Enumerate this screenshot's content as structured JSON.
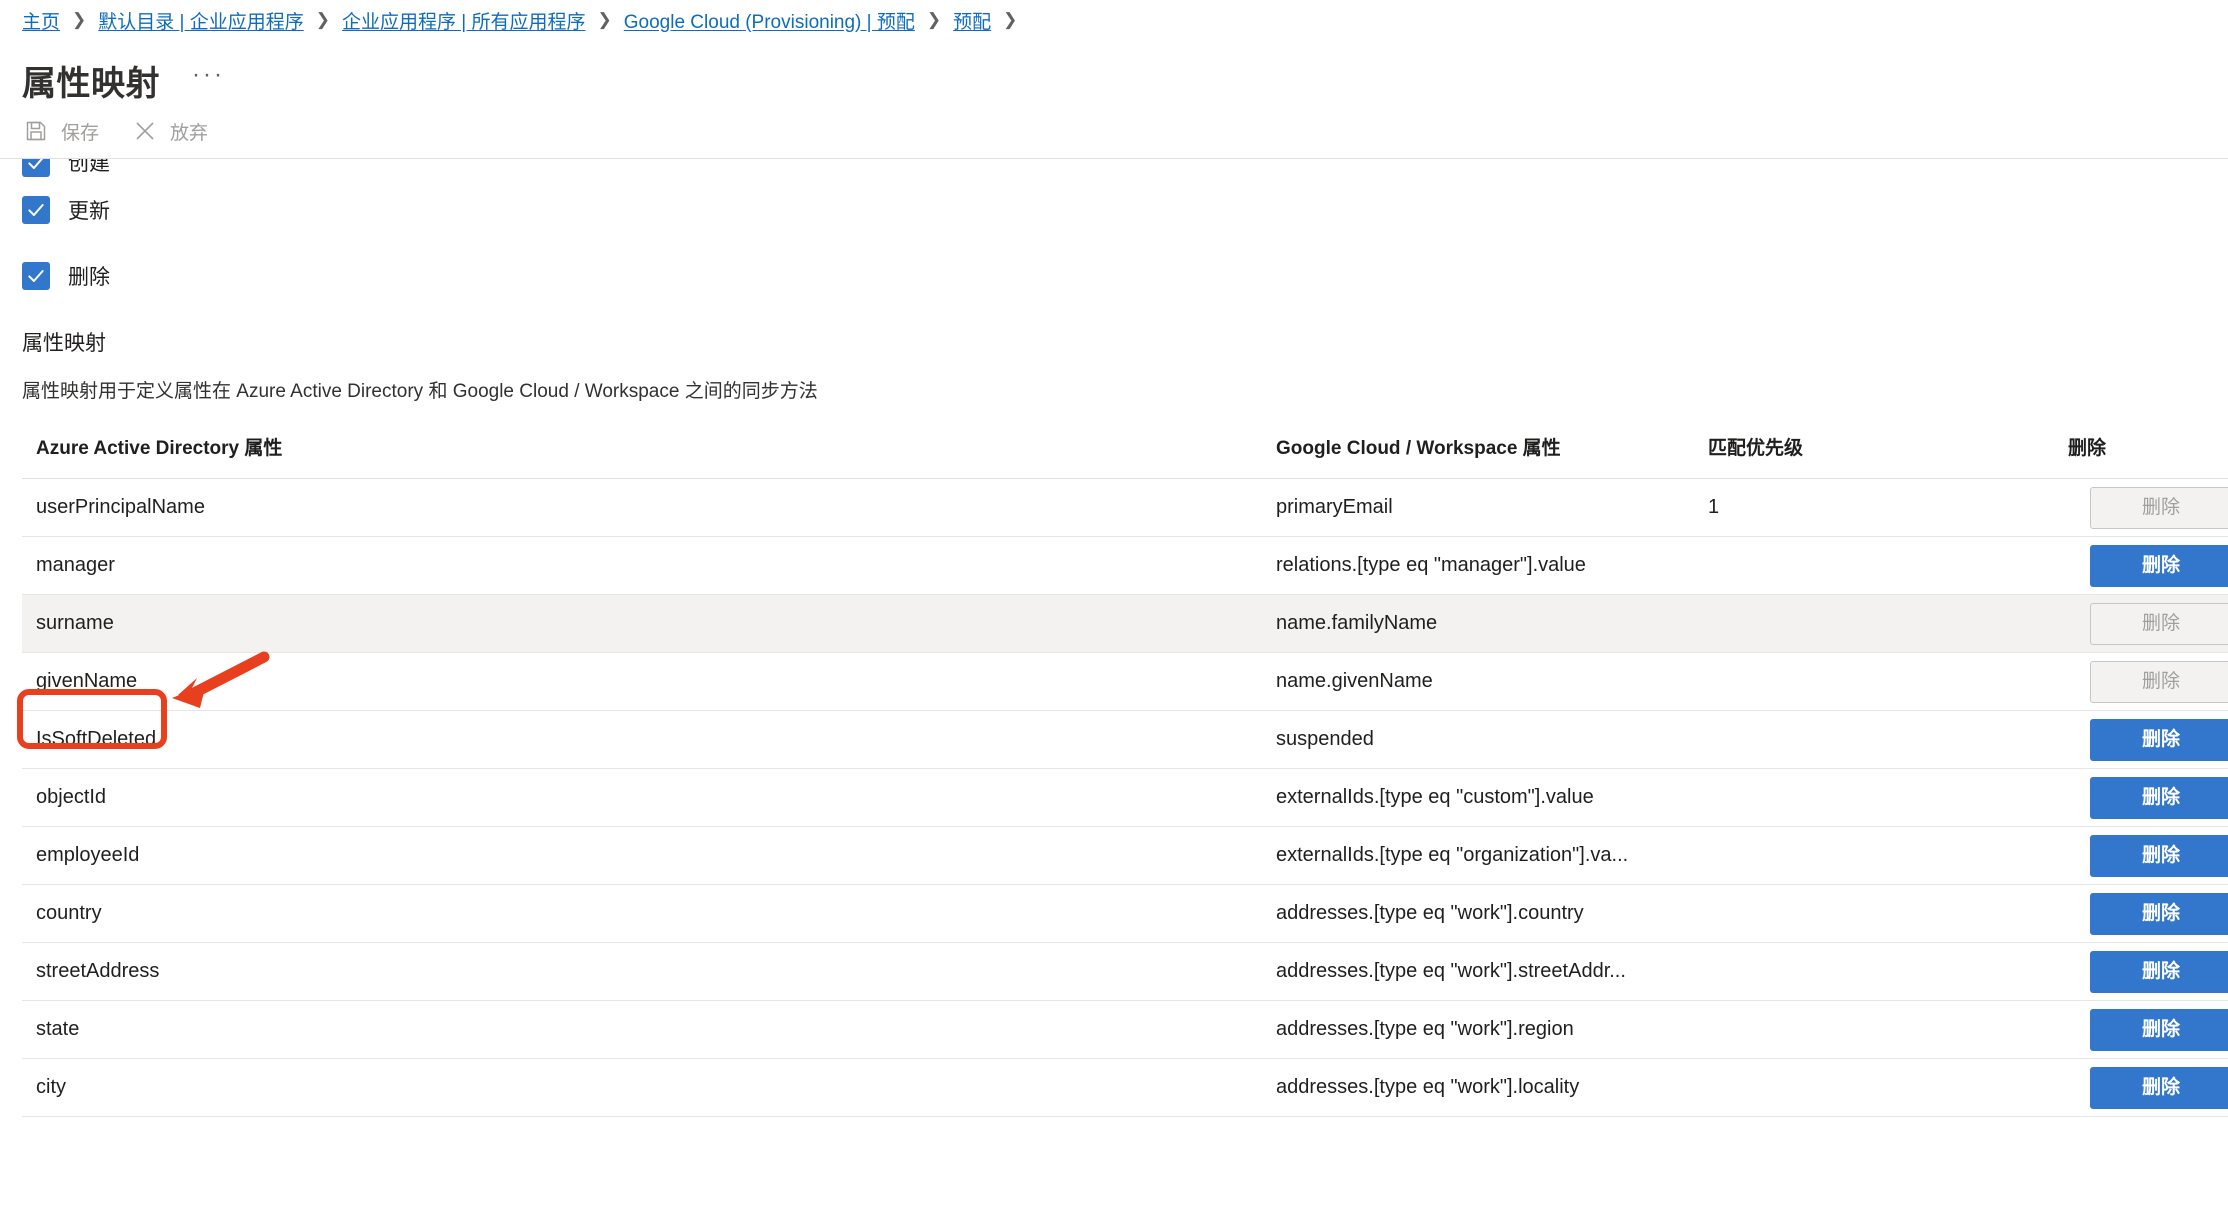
{
  "breadcrumb": {
    "items": [
      {
        "label": "主页"
      },
      {
        "label": "默认目录 | 企业应用程序"
      },
      {
        "label": "企业应用程序 | 所有应用程序"
      },
      {
        "label": "Google Cloud (Provisioning) | 预配"
      },
      {
        "label": "预配"
      }
    ],
    "separator": "❯"
  },
  "header": {
    "title": "属性映射",
    "more_label": "···"
  },
  "toolbar": {
    "save_label": "保存",
    "discard_label": "放弃",
    "save_icon": "save-floppy-icon",
    "discard_icon": "close-x-icon"
  },
  "checkboxes": [
    {
      "label": "创建",
      "checked": true,
      "clipped": true
    },
    {
      "label": "更新",
      "checked": true,
      "clipped": false
    },
    {
      "label": "删除",
      "checked": true,
      "clipped": false
    }
  ],
  "section": {
    "title": "属性映射",
    "description": "属性映射用于定义属性在 Azure Active Directory 和 Google Cloud / Workspace 之间的同步方法"
  },
  "table": {
    "columns": [
      "Azure Active Directory 属性",
      "Google Cloud / Workspace 属性",
      "匹配优先级",
      "删除"
    ],
    "delete_label": "删除",
    "rows": [
      {
        "source": "userPrincipalName",
        "target": "primaryEmail",
        "priority": "1",
        "delete_enabled": false,
        "highlight": false
      },
      {
        "source": "manager",
        "target": "relations.[type eq \"manager\"].value",
        "priority": "",
        "delete_enabled": true,
        "highlight": false
      },
      {
        "source": "surname",
        "target": "name.familyName",
        "priority": "",
        "delete_enabled": false,
        "highlight": true
      },
      {
        "source": "givenName",
        "target": "name.givenName",
        "priority": "",
        "delete_enabled": false,
        "highlight": false
      },
      {
        "source": "IsSoftDeleted",
        "target": "suspended",
        "priority": "",
        "delete_enabled": true,
        "highlight": false
      },
      {
        "source": "objectId",
        "target": "externalIds.[type eq \"custom\"].value",
        "priority": "",
        "delete_enabled": true,
        "highlight": false
      },
      {
        "source": "employeeId",
        "target": "externalIds.[type eq \"organization\"].va...",
        "priority": "",
        "delete_enabled": true,
        "highlight": false
      },
      {
        "source": "country",
        "target": "addresses.[type eq \"work\"].country",
        "priority": "",
        "delete_enabled": true,
        "highlight": false
      },
      {
        "source": "streetAddress",
        "target": "addresses.[type eq \"work\"].streetAddr...",
        "priority": "",
        "delete_enabled": true,
        "highlight": false
      },
      {
        "source": "state",
        "target": "addresses.[type eq \"work\"].region",
        "priority": "",
        "delete_enabled": true,
        "highlight": false
      },
      {
        "source": "city",
        "target": "addresses.[type eq \"work\"].locality",
        "priority": "",
        "delete_enabled": true,
        "highlight": false
      }
    ]
  },
  "annotation": {
    "highlight_color": "#e8401f",
    "target_row_source": "surname"
  },
  "colors": {
    "link": "#0f6cbd",
    "accent_blue": "#3277cc",
    "annotation_red": "#e8401f",
    "row_alt": "#f3f2f1"
  }
}
